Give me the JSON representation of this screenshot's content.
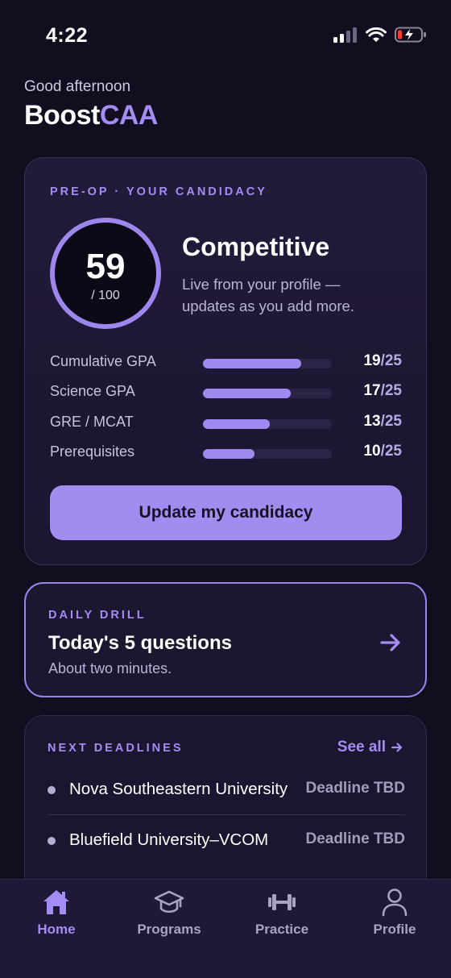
{
  "status_bar": {
    "time": "4:22"
  },
  "header": {
    "greeting": "Good afternoon",
    "brand_part1": "Boost",
    "brand_part2": "CAA"
  },
  "candidacy": {
    "eyebrow": "PRE-OP · YOUR CANDIDACY",
    "score": "59",
    "score_max": "/ 100",
    "tier": "Competitive",
    "subtitle": "Live from your profile — updates as you add more.",
    "factors": [
      {
        "label": "Cumulative GPA",
        "score": "19",
        "max": "/25",
        "value": 19,
        "out_of": 25
      },
      {
        "label": "Science GPA",
        "score": "17",
        "max": "/25",
        "value": 17,
        "out_of": 25
      },
      {
        "label": "GRE / MCAT",
        "score": "13",
        "max": "/25",
        "value": 13,
        "out_of": 25
      },
      {
        "label": "Prerequisites",
        "score": "10",
        "max": "/25",
        "value": 10,
        "out_of": 25
      }
    ],
    "button_label": "Update my candidacy"
  },
  "daily_drill": {
    "eyebrow": "DAILY DRILL",
    "title": "Today's 5 questions",
    "subtitle": "About two minutes."
  },
  "deadlines": {
    "eyebrow": "NEXT DEADLINES",
    "see_all": "See all",
    "items": [
      {
        "name": "Nova Southeastern University",
        "status": "Deadline TBD"
      },
      {
        "name": "Bluefield University–VCOM",
        "status": "Deadline TBD"
      }
    ]
  },
  "tabs": [
    {
      "label": "Home",
      "icon": "home-icon",
      "active": true
    },
    {
      "label": "Programs",
      "icon": "graduation-cap-icon",
      "active": false
    },
    {
      "label": "Practice",
      "icon": "dumbbell-icon",
      "active": false
    },
    {
      "label": "Profile",
      "icon": "user-icon",
      "active": false
    }
  ],
  "colors": {
    "accent": "#a48cf3",
    "background": "#120e1f",
    "card": "#1c1630"
  }
}
